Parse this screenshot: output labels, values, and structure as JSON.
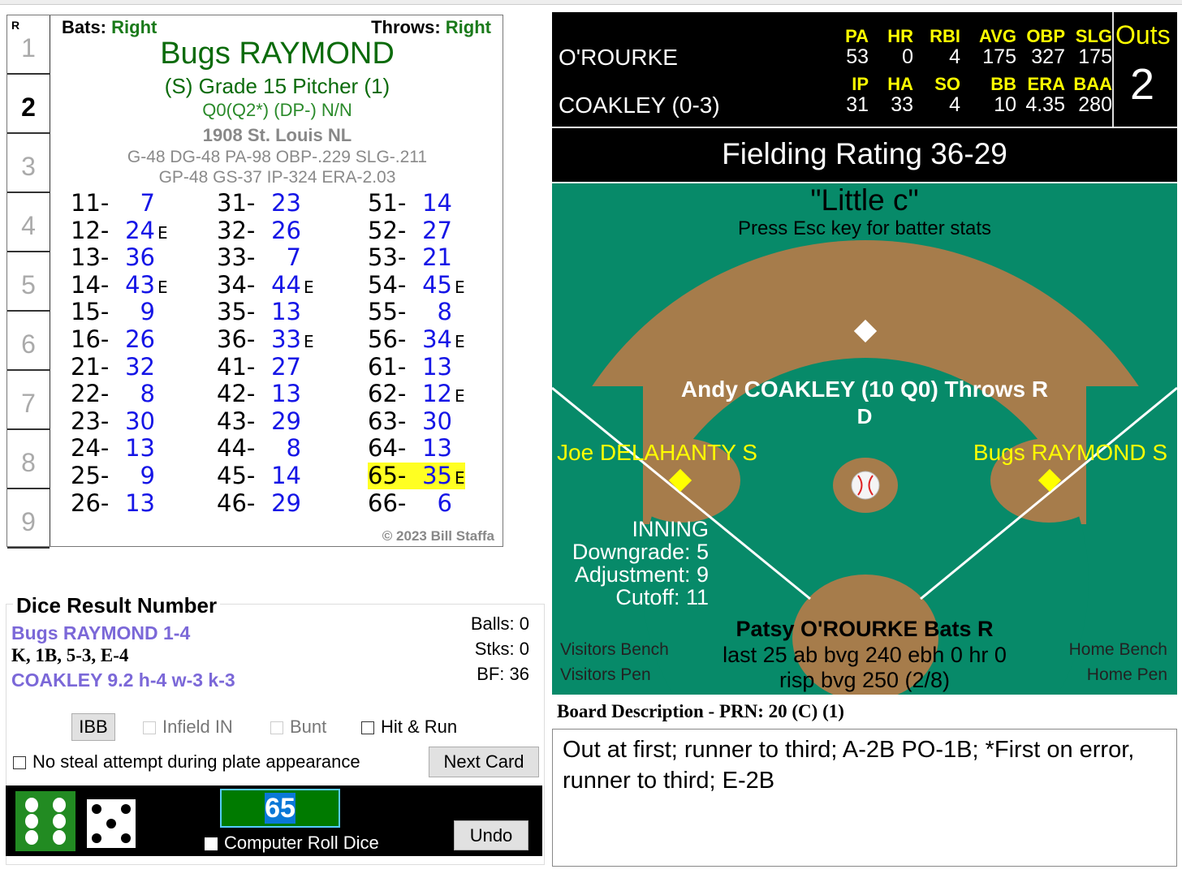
{
  "card": {
    "rotation_label": "R",
    "rows": [
      "1",
      "2",
      "3",
      "4",
      "5",
      "6",
      "7",
      "8",
      "9"
    ],
    "selected_row": "2",
    "bats_label": "Bats:",
    "bats": "Right",
    "throws_label": "Throws:",
    "throws": "Right",
    "name": "Bugs RAYMOND",
    "grade": "(S) Grade 15 Pitcher (1)",
    "ratings": "Q0(Q2*)  (DP-) N/N",
    "team": "1908 St. Louis NL",
    "stats1": "G-48 DG-48 PA-98 OBP-.229 SLG-.211",
    "stats2": "GP-48 GS-37 IP-324 ERA-2.03",
    "copyright": "© 2023 Bill Staffa",
    "columns": [
      [
        {
          "k": "11-",
          "v": "7",
          "e": ""
        },
        {
          "k": "12-",
          "v": "24",
          "e": "E"
        },
        {
          "k": "13-",
          "v": "36",
          "e": ""
        },
        {
          "k": "14-",
          "v": "43",
          "e": "E"
        },
        {
          "k": "15-",
          "v": "9",
          "e": ""
        },
        {
          "k": "16-",
          "v": "26",
          "e": ""
        },
        {
          "k": "21-",
          "v": "32",
          "e": ""
        },
        {
          "k": "22-",
          "v": "8",
          "e": ""
        },
        {
          "k": "23-",
          "v": "30",
          "e": ""
        },
        {
          "k": "24-",
          "v": "13",
          "e": ""
        },
        {
          "k": "25-",
          "v": "9",
          "e": ""
        },
        {
          "k": "26-",
          "v": "13",
          "e": ""
        }
      ],
      [
        {
          "k": "31-",
          "v": "23",
          "e": ""
        },
        {
          "k": "32-",
          "v": "26",
          "e": ""
        },
        {
          "k": "33-",
          "v": "7",
          "e": ""
        },
        {
          "k": "34-",
          "v": "44",
          "e": "E"
        },
        {
          "k": "35-",
          "v": "13",
          "e": ""
        },
        {
          "k": "36-",
          "v": "33",
          "e": "E"
        },
        {
          "k": "41-",
          "v": "27",
          "e": ""
        },
        {
          "k": "42-",
          "v": "13",
          "e": ""
        },
        {
          "k": "43-",
          "v": "29",
          "e": ""
        },
        {
          "k": "44-",
          "v": "8",
          "e": ""
        },
        {
          "k": "45-",
          "v": "14",
          "e": ""
        },
        {
          "k": "46-",
          "v": "29",
          "e": ""
        }
      ],
      [
        {
          "k": "51-",
          "v": "14",
          "e": ""
        },
        {
          "k": "52-",
          "v": "27",
          "e": ""
        },
        {
          "k": "53-",
          "v": "21",
          "e": ""
        },
        {
          "k": "54-",
          "v": "45",
          "e": "E"
        },
        {
          "k": "55-",
          "v": "8",
          "e": ""
        },
        {
          "k": "56-",
          "v": "34",
          "e": "E"
        },
        {
          "k": "61-",
          "v": "13",
          "e": ""
        },
        {
          "k": "62-",
          "v": "12",
          "e": "E"
        },
        {
          "k": "63-",
          "v": "30",
          "e": ""
        },
        {
          "k": "64-",
          "v": "13",
          "e": ""
        },
        {
          "k": "65-",
          "v": "35",
          "e": "E",
          "highlight": true
        },
        {
          "k": "66-",
          "v": "6",
          "e": ""
        }
      ]
    ]
  },
  "dice_panel": {
    "title": "Dice Result Number",
    "line1": "Bugs RAYMOND  1-4",
    "line2": "K, 1B, 5-3, E-4",
    "line3": "COAKLEY  9.2  h-4  w-3  k-3",
    "balls": "Balls: 0",
    "strikes": "Stks: 0",
    "bf": "BF: 36",
    "ibb": "IBB",
    "infield_in": "Infield IN",
    "bunt": "Bunt",
    "hit_run": "Hit & Run",
    "no_steal": "No steal attempt during plate appearance",
    "next_card": "Next Card",
    "result": "65",
    "computer_roll": "Computer Roll Dice",
    "undo": "Undo",
    "die1": 6,
    "die2": 5
  },
  "scoreboard": {
    "batter": "O'ROURKE",
    "pitcher": "COAKLEY (0-3)",
    "batter_headers": [
      "PA",
      "HR",
      "RBI",
      "AVG",
      "OBP",
      "SLG"
    ],
    "batter_values": [
      "53",
      "0",
      "4",
      "175",
      "327",
      "175"
    ],
    "pitcher_headers": [
      "IP",
      "HA",
      "SO",
      "BB",
      "ERA",
      "BAA"
    ],
    "pitcher_values": [
      "31",
      "33",
      "4",
      "10",
      "4.35",
      "280"
    ],
    "outs_label": "Outs",
    "outs": "2",
    "fielding": "Fielding Rating 36-29"
  },
  "field": {
    "title": "\"Little c\"",
    "hint": "Press Esc key for batter stats",
    "pitcher": "Andy COAKLEY (10 Q0) Throws R",
    "pitcher_sub": "D",
    "third": "Joe DELAHANTY S",
    "first": "Bugs RAYMOND S",
    "inning": "INNING",
    "downgrade": "Downgrade: 5",
    "adjustment": "Adjustment: 9",
    "cutoff": "Cutoff: 11",
    "batter": "Patsy O'ROURKE Bats R",
    "batter_line2": "last 25 ab bvg 240 ebh 0 hr 0",
    "batter_line3": "risp bvg 250 (2/8)",
    "visitors_bench": "Visitors Bench",
    "visitors_pen": "Visitors Pen",
    "home_bench": "Home Bench",
    "home_pen": "Home Pen",
    "colors": {
      "grass": "#078a69",
      "dirt": "#a67c4b",
      "runner": "#ffff00"
    }
  },
  "board_description": {
    "title": "Board Description - PRN: 20 (C) (1)",
    "text": "Out at first; runner to third; A-2B PO-1B; *First on error, runner to third; E-2B"
  }
}
